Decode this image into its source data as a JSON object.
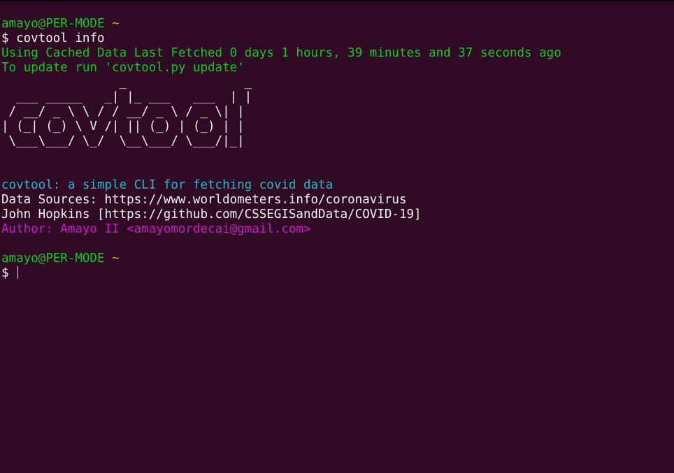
{
  "session1": {
    "prompt_user": "amayo@PER-MODE",
    "prompt_path": "~",
    "prompt_symbol": "$",
    "command": "covtool info"
  },
  "output": {
    "cache_line": "Using Cached Data Last Fetched 0 days 1 hours, 39 minutes and 37 seconds ago",
    "update_hint": "To update run 'covtool.py update'",
    "ascii_logo": "                _                _ \n  ___ _____   _| |_ ___   ___  | |\n / __/ _ \\ \\ / / __/ _ \\ / _ \\| |\n| (_| (_) \\ V /| || (_) | (_) | |\n \\___\\___/ \\_/  \\__\\___/ \\___/|_|",
    "description": "covtool: a simple CLI for fetching covid data",
    "sources_line": "Data Sources: https://www.worldometers.info/coronavirus",
    "sources_line2": "John Hopkins [https://github.com/CSSEGISandData/COVID-19]",
    "author_line": "Author: Amayo II <amayomordecai@gmail.com>"
  },
  "session2": {
    "prompt_user": "amayo@PER-MODE",
    "prompt_path": "~",
    "prompt_symbol": "$"
  },
  "colors": {
    "background": "#300a24",
    "prompt_user": "#13c720",
    "prompt_path": "#c4c000",
    "cache_text": "#13c720",
    "description": "#2ab8c6",
    "author": "#c41cc0",
    "default_text": "#f2f2f2"
  }
}
